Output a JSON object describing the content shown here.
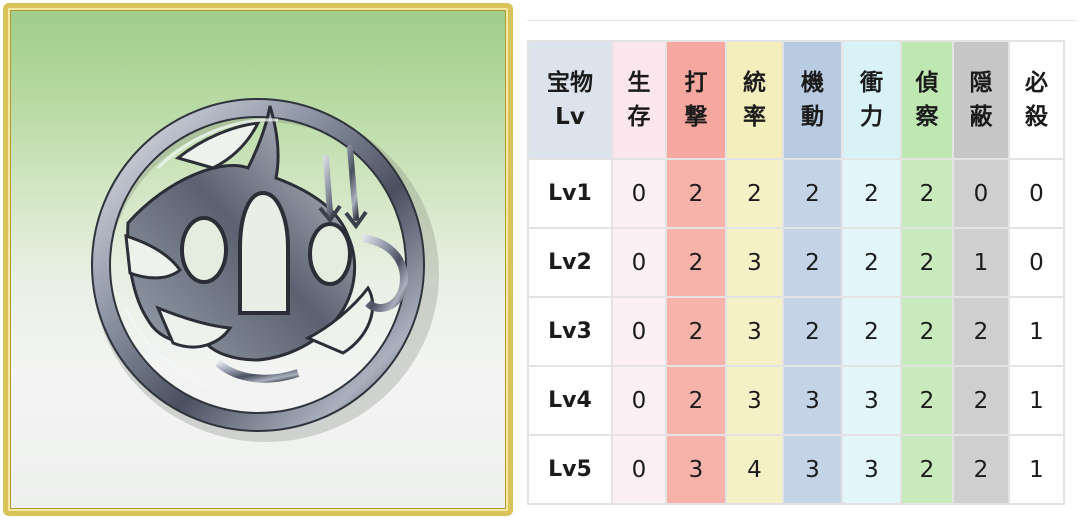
{
  "item": {
    "icon": "tsuba-sword-guard-icon",
    "frame_color": "#d8c45a"
  },
  "table": {
    "header": {
      "level_top": "宝物",
      "level_bottom": "Lv",
      "stats": [
        {
          "top": "生",
          "bottom": "存",
          "color": "#fbe6ee"
        },
        {
          "top": "打",
          "bottom": "撃",
          "color": "#f6a7a0"
        },
        {
          "top": "統",
          "bottom": "率",
          "color": "#f3eebb"
        },
        {
          "top": "機",
          "bottom": "動",
          "color": "#b9cbe0"
        },
        {
          "top": "衝",
          "bottom": "力",
          "color": "#d9f2f7"
        },
        {
          "top": "偵",
          "bottom": "察",
          "color": "#bfe7b2"
        },
        {
          "top": "隠",
          "bottom": "蔽",
          "color": "#c6c6c6"
        },
        {
          "top": "必",
          "bottom": "殺",
          "color": "#ffffff"
        }
      ]
    },
    "rows": [
      {
        "level": "Lv1",
        "values": [
          "0",
          "2",
          "2",
          "2",
          "2",
          "2",
          "0",
          "0"
        ]
      },
      {
        "level": "Lv2",
        "values": [
          "0",
          "2",
          "3",
          "2",
          "2",
          "2",
          "1",
          "0"
        ]
      },
      {
        "level": "Lv3",
        "values": [
          "0",
          "2",
          "3",
          "2",
          "2",
          "2",
          "2",
          "1"
        ]
      },
      {
        "level": "Lv4",
        "values": [
          "0",
          "2",
          "3",
          "3",
          "3",
          "2",
          "2",
          "1"
        ]
      },
      {
        "level": "Lv5",
        "values": [
          "0",
          "3",
          "4",
          "3",
          "3",
          "2",
          "2",
          "1"
        ]
      }
    ]
  }
}
